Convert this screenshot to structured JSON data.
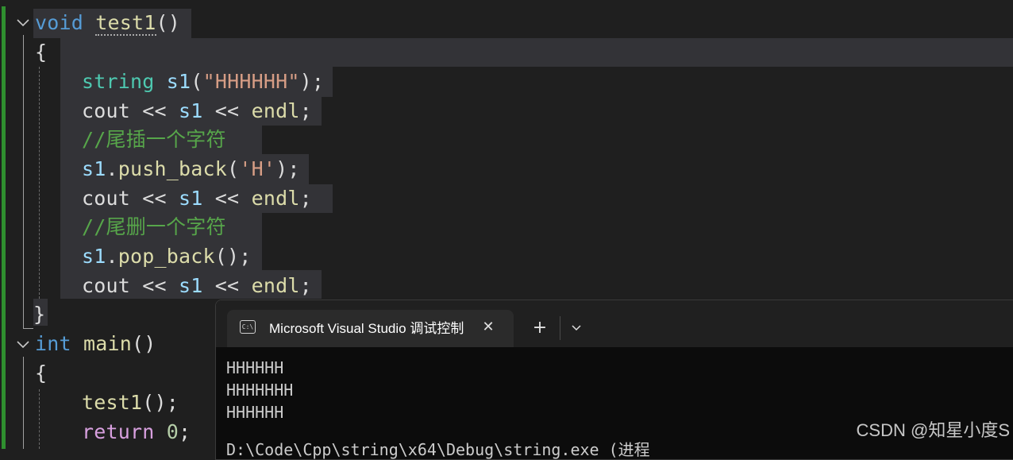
{
  "editor": {
    "lines": [
      [
        {
          "t": "void",
          "c": "kw"
        },
        {
          "t": " ",
          "c": "pun"
        },
        {
          "t": "test1",
          "c": "fn squiggle"
        },
        {
          "t": "()",
          "c": "pun"
        }
      ],
      [
        {
          "t": "{",
          "c": "pun"
        }
      ],
      [
        {
          "t": "string",
          "c": "ty"
        },
        {
          "t": " ",
          "c": "pun"
        },
        {
          "t": "s1",
          "c": "var"
        },
        {
          "t": "(",
          "c": "pun"
        },
        {
          "t": "\"HHHHHH\"",
          "c": "str"
        },
        {
          "t": ");",
          "c": "pun"
        }
      ],
      [
        {
          "t": "cout",
          "c": "pun"
        },
        {
          "t": " << ",
          "c": "pun"
        },
        {
          "t": "s1",
          "c": "var"
        },
        {
          "t": " << ",
          "c": "pun"
        },
        {
          "t": "endl",
          "c": "fn"
        },
        {
          "t": ";",
          "c": "pun"
        }
      ],
      [
        {
          "t": "//尾插一个字符",
          "c": "cmt"
        }
      ],
      [
        {
          "t": "s1",
          "c": "var"
        },
        {
          "t": ".",
          "c": "pun"
        },
        {
          "t": "push_back",
          "c": "fn"
        },
        {
          "t": "(",
          "c": "pun"
        },
        {
          "t": "'H'",
          "c": "str"
        },
        {
          "t": ");",
          "c": "pun"
        }
      ],
      [
        {
          "t": "cout",
          "c": "pun"
        },
        {
          "t": " << ",
          "c": "pun"
        },
        {
          "t": "s1",
          "c": "var"
        },
        {
          "t": " << ",
          "c": "pun"
        },
        {
          "t": "endl",
          "c": "fn"
        },
        {
          "t": ";",
          "c": "pun"
        }
      ],
      [
        {
          "t": "//尾删一个字符",
          "c": "cmt"
        }
      ],
      [
        {
          "t": "s1",
          "c": "var"
        },
        {
          "t": ".",
          "c": "pun"
        },
        {
          "t": "pop_back",
          "c": "fn"
        },
        {
          "t": "();",
          "c": "pun"
        }
      ],
      [
        {
          "t": "cout",
          "c": "pun"
        },
        {
          "t": " << ",
          "c": "pun"
        },
        {
          "t": "s1",
          "c": "var"
        },
        {
          "t": " << ",
          "c": "pun"
        },
        {
          "t": "endl",
          "c": "fn"
        },
        {
          "t": ";",
          "c": "pun"
        }
      ],
      [
        {
          "t": "}",
          "c": "pun"
        }
      ],
      [
        {
          "t": "int",
          "c": "kw"
        },
        {
          "t": " ",
          "c": "pun"
        },
        {
          "t": "main",
          "c": "fn"
        },
        {
          "t": "()",
          "c": "pun"
        }
      ],
      [
        {
          "t": "{",
          "c": "pun"
        }
      ],
      [
        {
          "t": "test1",
          "c": "fn"
        },
        {
          "t": "();",
          "c": "pun"
        }
      ],
      [
        {
          "t": "return",
          "c": "ctl"
        },
        {
          "t": " ",
          "c": "pun"
        },
        {
          "t": "0",
          "c": "num"
        },
        {
          "t": ";",
          "c": "pun"
        }
      ]
    ],
    "fold_icon": "chevron-down-icon"
  },
  "terminal": {
    "tab_title": "Microsoft Visual Studio 调试控制台",
    "tab_icon": "terminal-icon",
    "close_icon": "close-icon",
    "new_tab_label": "+",
    "dropdown_icon": "chevron-down-icon",
    "output": [
      "HHHHHH",
      "HHHHHHH",
      "HHHHHH"
    ],
    "partial_line": "D:\\Code\\Cpp\\string\\x64\\Debug\\string.exe (进程"
  },
  "watermark": "CSDN @知星小度S"
}
